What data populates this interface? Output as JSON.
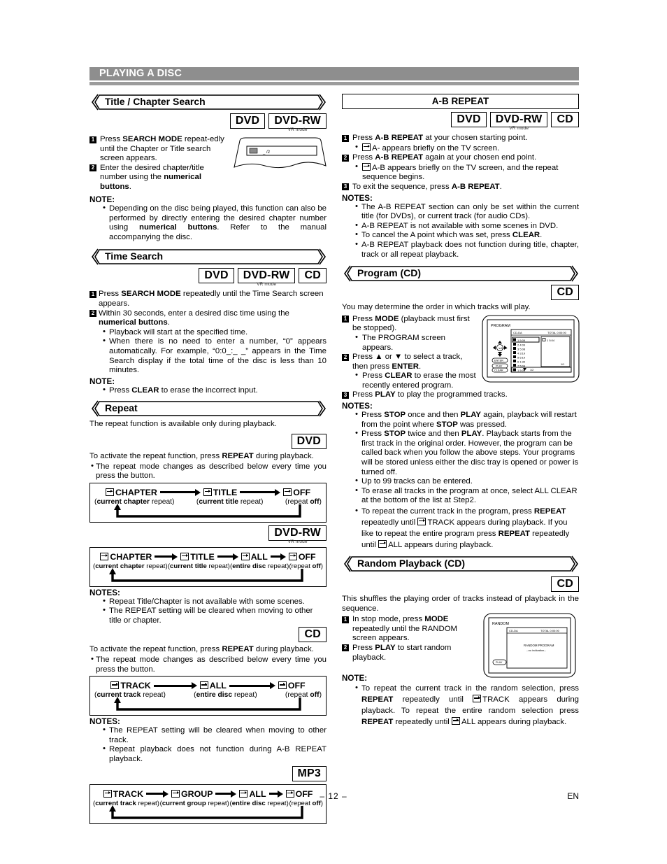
{
  "banner": {
    "title": "PLAYING A DISC"
  },
  "footer": {
    "page": "– 12 –",
    "lang": "EN"
  },
  "left": {
    "title_chapter_search": {
      "heading": "Title / Chapter Search",
      "badges": [
        {
          "label": "DVD",
          "sub": ""
        },
        {
          "label": "DVD-RW",
          "sub": "VR mode"
        }
      ],
      "step1": "Press SEARCH MODE repeatedly until the Chapter or Title search screen appears.",
      "step1_parts": {
        "a": "Press ",
        "b": "SEARCH MODE",
        "c": " repeat-edly until the Chapter or Title search screen appears."
      },
      "step2_parts": {
        "a": "Enter the desired chapter/title number using the ",
        "b": "numerical buttons",
        "c": "."
      },
      "note_label": "NOTE:",
      "note1_parts": {
        "a": "Depending on the disc being played, this function can also be performed by directly entering the desired chapter number using ",
        "b": "numerical buttons",
        "c": ". Refer to the manual accompanying the disc."
      },
      "osd_value": "_ /2"
    },
    "time_search": {
      "heading": "Time Search",
      "badges": [
        {
          "label": "DVD",
          "sub": ""
        },
        {
          "label": "DVD-RW",
          "sub": "VR mode"
        },
        {
          "label": "CD",
          "sub": ""
        }
      ],
      "step1_parts": {
        "a": "Press ",
        "b": "SEARCH MODE",
        "c": " repeatedly until the Time Search screen appears."
      },
      "step2_parts": {
        "a": "Within 30 seconds, enter a desired disc time using the ",
        "b": "numerical buttons",
        "c": "."
      },
      "bullet1": "Playback will start at the specified time.",
      "bullet2": "When there is no need to enter a number, “0” appears automatically. For example, “0:0_:_ _” appears in the Time Search display if the total time of the disc is less than 10 minutes.",
      "note_label": "NOTE:",
      "note1_parts": {
        "a": "Press ",
        "b": "CLEAR",
        "c": " to erase the incorrect input."
      }
    },
    "repeat": {
      "heading": "Repeat",
      "intro": "The repeat function is available only during playback.",
      "dvd": {
        "badge": "DVD",
        "line1_parts": {
          "a": "To activate the repeat function, press ",
          "b": "REPEAT",
          "c": " during playback."
        },
        "line2": "The repeat mode changes as described below every time you press the button.",
        "nodes": [
          "CHAPTER",
          "TITLE",
          "OFF"
        ],
        "captions": [
          {
            "bold": "current chapter",
            "rest": " repeat"
          },
          {
            "bold": "current title",
            "rest": " repeat"
          },
          {
            "pre": "repeat ",
            "boldend": "off"
          }
        ]
      },
      "dvdrw": {
        "badge": "DVD-RW",
        "badge_sub": "VR mode",
        "nodes": [
          "CHAPTER",
          "TITLE",
          "ALL",
          "OFF"
        ],
        "captions": [
          {
            "bold": "current chapter",
            "rest": " repeat"
          },
          {
            "bold": "current title",
            "rest": " repeat"
          },
          {
            "bold": "entire disc",
            "rest": " repeat"
          },
          {
            "pre": "repeat ",
            "boldend": "off"
          }
        ],
        "notes_label": "NOTES:",
        "note1": "Repeat Title/Chapter is not available with some scenes.",
        "note2": "The REPEAT setting will be cleared when moving to other title or chapter."
      },
      "cd": {
        "badge": "CD",
        "line1_parts": {
          "a": "To activate the repeat function, press ",
          "b": "REPEAT",
          "c": " during playback."
        },
        "line2": "The repeat mode changes as described below every time you press the button.",
        "nodes": [
          "TRACK",
          "ALL",
          "OFF"
        ],
        "captions": [
          {
            "bold": "current track",
            "rest": " repeat"
          },
          {
            "bold": "entire disc",
            "rest": " repeat"
          },
          {
            "pre": "repeat ",
            "boldend": "off"
          }
        ],
        "notes_label": "NOTES:",
        "note1": "The REPEAT setting will be cleared when moving to other track.",
        "note2": "Repeat playback does not function during A-B REPEAT playback."
      },
      "mp3": {
        "badge": "MP3",
        "nodes": [
          "TRACK",
          "GROUP",
          "ALL",
          "OFF"
        ],
        "captions": [
          {
            "bold": "current track",
            "rest": " repeat"
          },
          {
            "bold": "current group",
            "rest": " repeat"
          },
          {
            "bold": "entire disc",
            "rest": " repeat"
          },
          {
            "pre": "repeat ",
            "boldend": "off"
          }
        ]
      }
    }
  },
  "right": {
    "ab_repeat": {
      "heading": "A-B REPEAT",
      "badges": [
        {
          "label": "DVD",
          "sub": ""
        },
        {
          "label": "DVD-RW",
          "sub": "VR mode"
        },
        {
          "label": "CD",
          "sub": ""
        }
      ],
      "step1_parts": {
        "a": "Press ",
        "b": "A-B REPEAT",
        "c": "  at your chosen starting point."
      },
      "sub1": "A- appears briefly on the TV screen.",
      "step2_parts": {
        "a": "Press ",
        "b": "A-B REPEAT",
        "c": "  again at your chosen end point."
      },
      "sub2": "A-B appears briefly on the TV screen, and the repeat sequence begins.",
      "step3_parts": {
        "a": "To exit the sequence, press ",
        "b": "A-B REPEAT",
        "c": "."
      },
      "notes_label": "NOTES:",
      "note1": "The A-B REPEAT section can only be set within the current title (for DVDs), or current track (for audio CDs).",
      "note2": "A-B REPEAT is not available with some scenes in DVD.",
      "note3_parts": {
        "a": "To cancel the A point which was set, press ",
        "b": "CLEAR",
        "c": "."
      },
      "note4": "A-B REPEAT playback does not function during title, chapter, track or all repeat playback."
    },
    "program": {
      "heading": "Program (CD)",
      "badges": [
        {
          "label": "CD",
          "sub": ""
        }
      ],
      "intro": "You may determine the order in which tracks will play.",
      "step1_parts": {
        "a": "Press ",
        "b": "MODE",
        "c": " (playback must first be stopped)."
      },
      "sub1": "The PROGRAM screen appears.",
      "step2_parts": {
        "a": "Press ▲ or ▼ to select a track, then press ",
        "b": "ENTER",
        "c": "."
      },
      "sub2_parts": {
        "a": "Press ",
        "b": "CLEAR",
        "c": " to erase the most recently entered program."
      },
      "step3_parts": {
        "a": "Press ",
        "b": "PLAY",
        "c": " to play the programmed tracks."
      },
      "notes_label": "NOTES:",
      "note1_parts": {
        "a": "Press ",
        "b": "STOP",
        "c": " once and then ",
        "d": "PLAY",
        "e": " again, playback will restart from the point where ",
        "f": "STOP",
        "g": " was pressed."
      },
      "note2_parts": {
        "a": "Press ",
        "b": "STOP",
        "c": " twice and then ",
        "d": "PLAY",
        "e": ".  Playback starts from the first track in the original order. However, the program can be called back when you follow the above steps. Your programs will be stored unless either the disc tray is opened or power is turned off."
      },
      "note3": "Up to 99 tracks can be entered.",
      "note4": "To erase all tracks in the program at once, select ALL CLEAR at the bottom of the list at Step2.",
      "note5_a": "To repeat the current track in the program, press ",
      "note5_b": "REPEAT",
      "note5_c": " repeatedly until",
      "note5_d": "TRACK appears during playback. If you like to repeat the entire program press ",
      "note5_e": "REPEAT",
      "note5_f": " repeatedly until",
      "note5_g": "ALL appears during playback.",
      "osd": {
        "title": "PROGRAM",
        "disc": "CD-DA",
        "total": "TOTAL 0:00:00",
        "tracks": [
          "1  5:09",
          "2  4:09",
          "3  5:08",
          "4  3:19",
          "5  5:19",
          "6  1:39",
          "7  5:04"
        ],
        "selected": "1  5:04",
        "bottom": "1  5:09",
        "pager_left": "1/2",
        "pager_right": "1/1",
        "buttons": [
          "ENTER",
          "PLAY",
          "CLEAR"
        ]
      }
    },
    "random": {
      "heading": "Random Playback (CD)",
      "badges": [
        {
          "label": "CD",
          "sub": ""
        }
      ],
      "intro": "This shuffles the playing order of tracks instead of playback in the sequence.",
      "step1_parts": {
        "a": "In stop mode, press ",
        "b": "MODE",
        "c": " repeatedly until the RANDOM screen appears."
      },
      "step2_parts": {
        "a": "Press ",
        "b": "PLAY",
        "c": " to start random playback."
      },
      "note_label": "NOTE:",
      "note1_a": "To repeat the current track in the random selection, press ",
      "note1_b": "REPEAT",
      "note1_c": " repeatedly until",
      "note1_d": "TRACK appears during playback. To repeat the entire random selection press ",
      "note1_e": "REPEAT",
      "note1_f": " repeatedly until",
      "note1_g": "ALL appears during playback.",
      "osd": {
        "title": "RANDOM",
        "disc": "CD-DA",
        "total": "TOTAL  0:00:00",
        "line1": "RANDOM PROGRAM",
        "line2": "--no indication--",
        "button": "PLAY"
      }
    }
  },
  "colors": {
    "banner": "#8e8e8e",
    "banner_rule": "#9c9c9c",
    "ink": "#000000"
  }
}
